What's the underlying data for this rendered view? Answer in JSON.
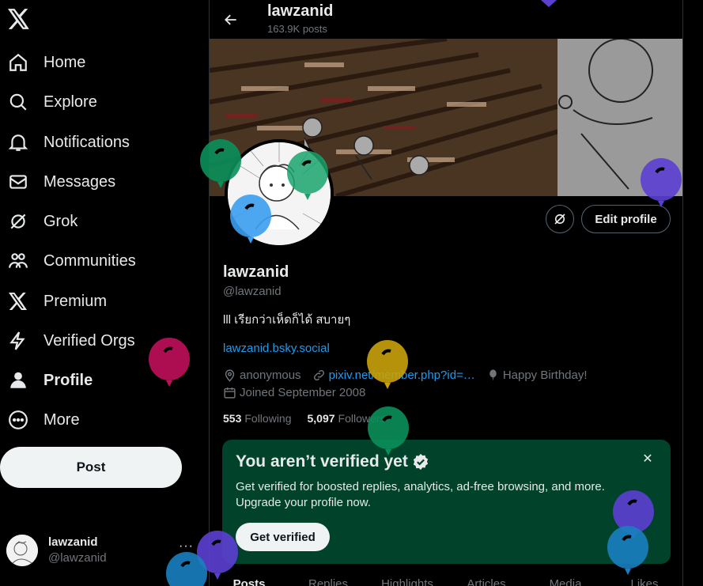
{
  "app": "X",
  "nav": [
    {
      "label": "Home",
      "icon": "home-icon"
    },
    {
      "label": "Explore",
      "icon": "search-icon"
    },
    {
      "label": "Notifications",
      "icon": "bell-icon"
    },
    {
      "label": "Messages",
      "icon": "mail-icon"
    },
    {
      "label": "Grok",
      "icon": "grok-icon"
    },
    {
      "label": "Communities",
      "icon": "communities-icon"
    },
    {
      "label": "Premium",
      "icon": "x-logo-icon"
    },
    {
      "label": "Verified Orgs",
      "icon": "lightning-icon"
    },
    {
      "label": "Profile",
      "icon": "person-icon",
      "active": true
    },
    {
      "label": "More",
      "icon": "more-circle-icon"
    }
  ],
  "post_button": "Post",
  "account": {
    "name": "lawzanid",
    "handle": "@lawzanid",
    "menu": "···"
  },
  "header": {
    "name": "lawzanid",
    "posts": "163.9K posts"
  },
  "profile": {
    "edit_button": "Edit profile",
    "name": "lawzanid",
    "handle": "@lawzanid",
    "bio": "lll เรียกว่าเห็ดก็ได้ สบายๆ",
    "link": "lawzanid.bsky.social",
    "location": "anonymous",
    "website": "pixiv.net/member.php?id=…",
    "birthday": "Happy Birthday!",
    "joined": "Joined September 2008",
    "following_count": "553",
    "following_label": "Following",
    "followers_count": "5,097",
    "followers_label": "Followers"
  },
  "verify_card": {
    "title": "You aren’t verified yet",
    "description": "Get verified for boosted replies, analytics, ad-free browsing, and more. Upgrade your profile now.",
    "button": "Get verified",
    "close": "✕"
  },
  "tabs": [
    "Posts",
    "Replies",
    "Highlights",
    "Articles",
    "Media",
    "Likes"
  ],
  "colors": {
    "accent": "#1d9bf0",
    "card": "#00432a",
    "muted": "#71767b"
  }
}
